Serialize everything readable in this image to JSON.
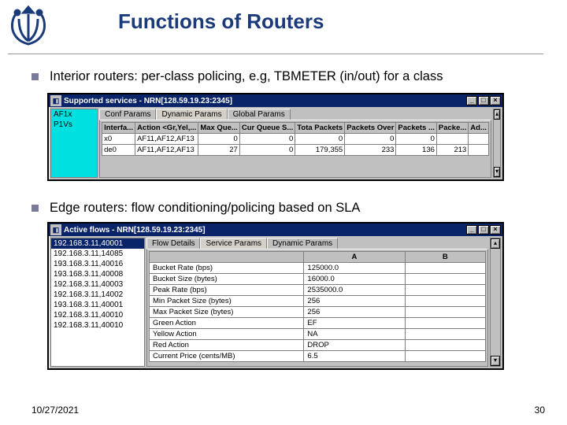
{
  "slide": {
    "title": "Functions of Routers",
    "bullet1": "Interior routers: per-class policing, e.g, TBMETER (in/out) for a class",
    "bullet2": "Edge routers: flow conditioning/policing based on SLA",
    "date": "10/27/2021",
    "page": "30"
  },
  "win1": {
    "title": "Supported services - NRN[128.59.19.23:2345]",
    "btns": {
      "min": "_",
      "max": "□",
      "close": "×"
    },
    "side_header": "",
    "side_items": [
      "AF1x",
      "P1Vs",
      ""
    ],
    "tabs": [
      "Conf Params",
      "Dynamic Params",
      "Global Params"
    ],
    "active_tab": 1,
    "columns": [
      "Interfa...",
      "Action <Gr,Yel,...",
      "Max Que...",
      "Cur Queue S...",
      "Tota Packets",
      "Packets Over",
      "Packets ...",
      "Packe...",
      "Ad..."
    ],
    "rows": [
      [
        "x0",
        "AF11,AF12,AF13",
        "0",
        "0",
        "0",
        "0",
        "0",
        "",
        ""
      ],
      [
        "de0",
        "AF11,AF12,AF13",
        "27",
        "0",
        "179,355",
        "233",
        "136",
        "213",
        ""
      ]
    ]
  },
  "win2": {
    "title": "Active flows - NRN[128.59.19.23:2345]",
    "btns": {
      "min": "_",
      "max": "□",
      "close": "×"
    },
    "side_items": [
      "192.168.3.11,40001",
      "192.168.3.11,14085",
      "193.168.3.11,40016",
      "193.168.3.11,40008",
      "192.168.3.11,40003",
      "192.168.3.11,14002",
      "193.168.3.11,40001",
      "192.168.3.11,40010",
      "192.168.3.11,40010"
    ],
    "tabs": [
      "Flow Details",
      "Service Params",
      "Dynamic Params"
    ],
    "active_tab": 1,
    "col_headers": [
      "",
      "A",
      "B"
    ],
    "params": [
      {
        "label": "Bucket Rate (bps)",
        "a": "125000.0",
        "b": ""
      },
      {
        "label": "Bucket Size (bytes)",
        "a": "16000.0",
        "b": ""
      },
      {
        "label": "Peak Rate (bps)",
        "a": "2535000.0",
        "b": ""
      },
      {
        "label": "Min Packet Size (bytes)",
        "a": "256",
        "b": ""
      },
      {
        "label": "Max Packet Size (bytes)",
        "a": "256",
        "b": ""
      },
      {
        "label": "Green Action",
        "a": "EF",
        "b": ""
      },
      {
        "label": "Yellow Action",
        "a": "NA",
        "b": ""
      },
      {
        "label": "Red Action",
        "a": "DROP",
        "b": ""
      },
      {
        "label": "Current Price (cents/MB)",
        "a": "6.5",
        "b": ""
      }
    ]
  }
}
